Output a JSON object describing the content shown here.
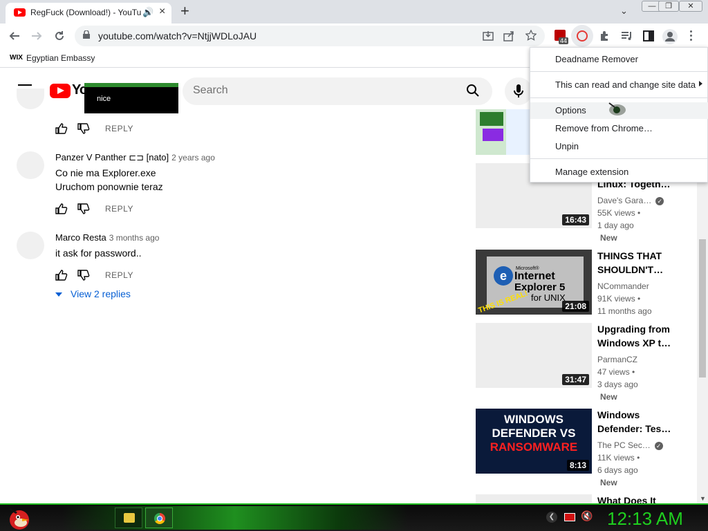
{
  "browser": {
    "tab_title": "RegFuck (Download!) - YouTube",
    "audio_icon": "speaker-icon",
    "tab_close": "×",
    "new_tab": "+",
    "tab_search": "⌄",
    "win_minimize": "—",
    "win_restore": "❐",
    "win_close": "✕",
    "url": "youtube.com/watch?v=NtjjWDLoJAU",
    "bookmark_label": "Egyptian Embassy",
    "bookmark_logo": "WIX",
    "extension_badge": "44"
  },
  "yt": {
    "logo_text": "YouTube",
    "search_placeholder": "Search",
    "tooltip_text": "nice"
  },
  "comments": [
    {
      "author": "",
      "time": "",
      "text": "",
      "reply": "REPLY"
    },
    {
      "author": "Panzer V Panther ⊏⊐ [nato]",
      "time": "2 years ago",
      "text": [
        "Co nie ma Explorer.exe",
        "Uruchom ponownie teraz"
      ],
      "reply": "REPLY"
    },
    {
      "author": "Marco Resta",
      "time": "3 months ago",
      "text": [
        "it ask for password.."
      ],
      "reply": "REPLY"
    }
  ],
  "view_replies": "View 2 replies",
  "sidebar": [
    {
      "title_l1": "Linux: Togeth…",
      "channel": "Dave's Gara…",
      "views": "55K views •",
      "age": "1 day ago",
      "badge": "New",
      "duration": "16:43",
      "verified": true
    },
    {
      "title_l1": "THINGS THAT",
      "title_l2": "SHOULDN'T…",
      "channel": "NCommander",
      "views": "91K views •",
      "age": "11 months ago",
      "badge": "",
      "duration": "21:08",
      "verified": false,
      "thumb_text": [
        "Microsoft®",
        "Internet",
        "Explorer 5",
        "for UNIX",
        "THIS IS REAL!"
      ]
    },
    {
      "title_l1": "Upgrading from",
      "title_l2": "Windows XP t…",
      "channel": "ParmanCZ",
      "views": "47 views •",
      "age": "3 days ago",
      "badge": "New",
      "duration": "31:47",
      "verified": false
    },
    {
      "title_l1": "Windows",
      "title_l2": "Defender: Tes…",
      "channel": "The PC Sec…",
      "views": "11K views •",
      "age": "6 days ago",
      "badge": "New",
      "duration": "8:13",
      "verified": true,
      "thumb_text": [
        "WINDOWS",
        "DEFENDER VS",
        "RANSOMWARE"
      ]
    },
    {
      "title_l1": "What Does It"
    }
  ],
  "ext_menu": {
    "name": "Deadname Remover",
    "site_access": "This can read and change site data",
    "options": "Options",
    "remove": "Remove from Chrome…",
    "unpin": "Unpin",
    "manage": "Manage extension"
  },
  "taskbar": {
    "clock": "12:13 AM",
    "apps": [
      "folder-icon",
      "chrome-icon"
    ],
    "tray": [
      "network-icon",
      "flag-icon",
      "volume-muted-icon"
    ]
  },
  "colors": {
    "accent_blue": "#065fd4",
    "yt_red": "#ff0000",
    "taskbar_green": "#1fcf1f"
  }
}
